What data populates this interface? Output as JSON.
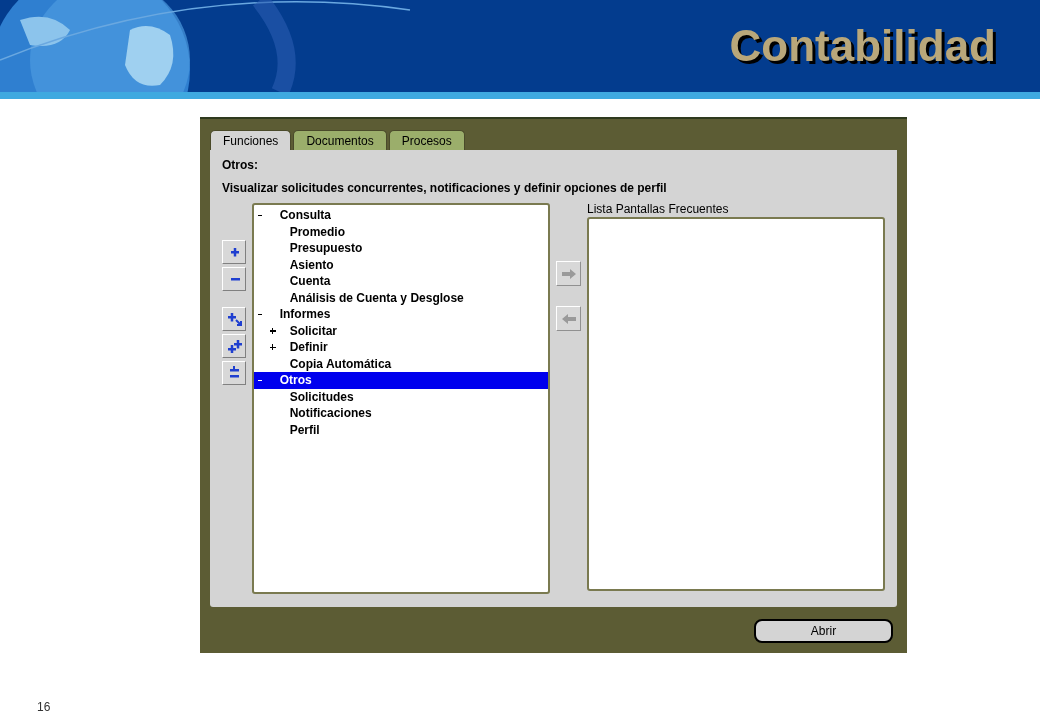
{
  "slide": {
    "title": "Contabilidad",
    "page_number": "16"
  },
  "tabs": [
    {
      "label": "Funciones",
      "selected": true
    },
    {
      "label": "Documentos",
      "selected": false
    },
    {
      "label": "Procesos",
      "selected": false
    }
  ],
  "heading": "Otros:",
  "description": "Visualizar solicitudes concurrentes, notificaciones y definir opciones de perfil",
  "tree": [
    {
      "label": "Consulta",
      "expanded": true,
      "selected": false,
      "children": [
        {
          "label": "Promedio",
          "selected": false
        },
        {
          "label": "Presupuesto",
          "selected": false
        },
        {
          "label": "Asiento",
          "selected": false
        },
        {
          "label": "Cuenta",
          "selected": false
        },
        {
          "label": "Análisis de Cuenta y Desglose",
          "selected": false
        }
      ]
    },
    {
      "label": "Informes",
      "expanded": true,
      "selected": false,
      "children": [
        {
          "label": "Solicitar",
          "expanded": false,
          "selected": false
        },
        {
          "label": "Definir",
          "expanded": false,
          "selected": false
        },
        {
          "label": "Copia Automática",
          "selected": false
        }
      ]
    },
    {
      "label": "Otros",
      "expanded": true,
      "selected": true,
      "children": [
        {
          "label": "Solicitudes",
          "selected": false
        },
        {
          "label": "Notificaciones",
          "selected": false
        },
        {
          "label": "Perfil",
          "selected": false
        }
      ]
    }
  ],
  "tree_buttons": [
    {
      "kind": "expand"
    },
    {
      "kind": "collapse"
    },
    {
      "kind": "expand-branch"
    },
    {
      "kind": "expand-all"
    },
    {
      "kind": "collapse-all"
    }
  ],
  "move_buttons": [
    {
      "kind": "add",
      "disabled": true
    },
    {
      "kind": "remove",
      "disabled": true
    }
  ],
  "frequent_list": {
    "label": "Lista Pantallas Frecuentes"
  },
  "open_button": "Abrir"
}
